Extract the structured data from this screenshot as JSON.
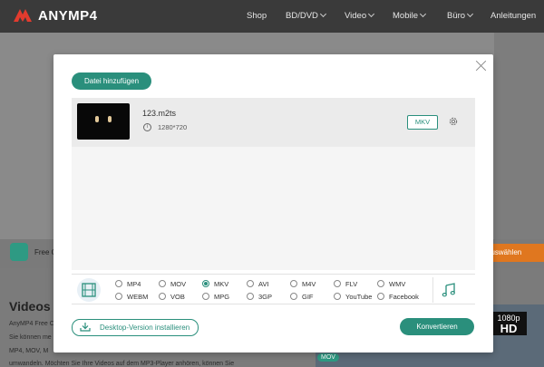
{
  "site": {
    "logo_text": "ANYMP4",
    "nav": [
      {
        "label": "Shop"
      },
      {
        "label": "BD/DVD"
      },
      {
        "label": "Video"
      },
      {
        "label": "Mobile"
      },
      {
        "label": "Büro"
      },
      {
        "label": "Anleitungen"
      }
    ],
    "strip_text": "Free C",
    "strip_button": "auswählen",
    "lower_title": "Videos k",
    "lower_lines": [
      "AnyMP4 Free C",
      "Sie können me",
      "MP4, MOV, M",
      "umwandeln. Möchten Sie Ihre Videos auf dem MP3-Player anhören, können Sie"
    ],
    "hd_badge_top": "1080p",
    "hd_badge_bottom": "HD",
    "mov_tag": "MOV"
  },
  "modal": {
    "add_button": "Datei hinzufügen",
    "file": {
      "name": "123.m2ts",
      "resolution": "1280*720",
      "format": "MKV"
    },
    "formats": {
      "row1": [
        "MP4",
        "MOV",
        "MKV",
        "AVI",
        "M4V",
        "FLV",
        "WMV"
      ],
      "row2": [
        "WEBM",
        "VOB",
        "MPG",
        "3GP",
        "GIF",
        "YouTube",
        "Facebook"
      ],
      "selected": "MKV"
    },
    "install_button": "Desktop-Version installieren",
    "convert_button": "Konvertieren"
  },
  "colors": {
    "accent": "#2a8f7c",
    "overlay": "#8a8a8a",
    "orange": "#e0771f"
  }
}
